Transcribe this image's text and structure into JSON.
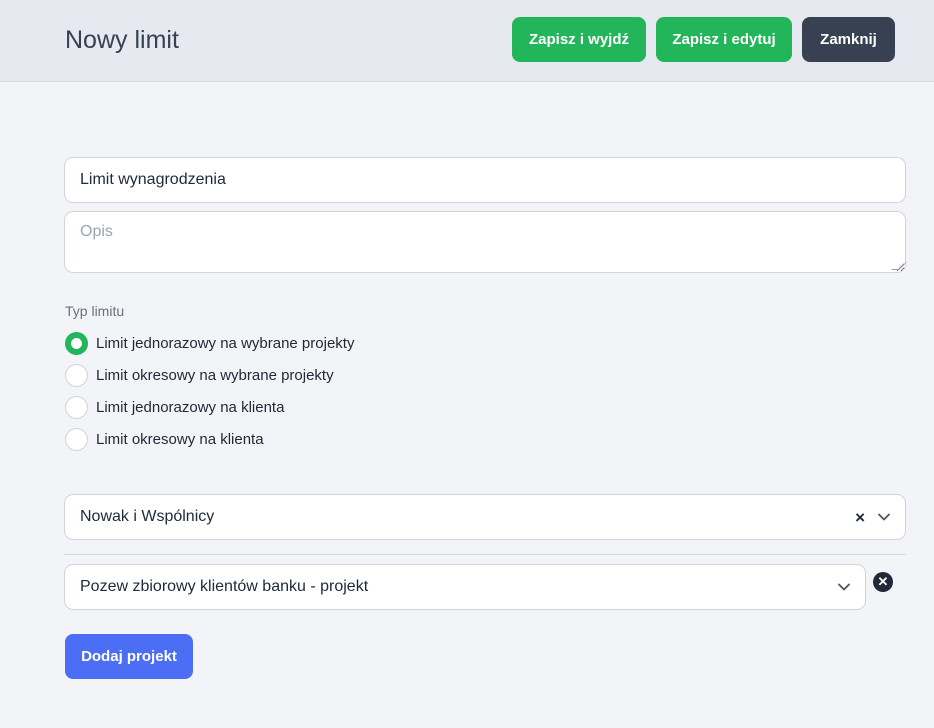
{
  "header": {
    "title": "Nowy limit",
    "buttons": {
      "save_exit": "Zapisz i wyjdź",
      "save_edit": "Zapisz i edytuj",
      "close": "Zamknij"
    }
  },
  "form": {
    "name_value": "Limit wynagrodzenia",
    "description_placeholder": "Opis",
    "limit_type_label": "Typ limitu",
    "limit_types": [
      {
        "label": "Limit jednorazowy na wybrane projekty",
        "checked": true
      },
      {
        "label": "Limit okresowy na wybrane projekty",
        "checked": false
      },
      {
        "label": "Limit jednorazowy na klienta",
        "checked": false
      },
      {
        "label": "Limit okresowy na klienta",
        "checked": false
      }
    ],
    "client_selected": "Nowak i Wspólnicy",
    "project_selected": "Pozew zbiorowy klientów banku - projekt",
    "add_project_label": "Dodaj projekt"
  },
  "colors": {
    "green": "#22b55a",
    "dark": "#374151",
    "blue": "#4c6ef5"
  }
}
